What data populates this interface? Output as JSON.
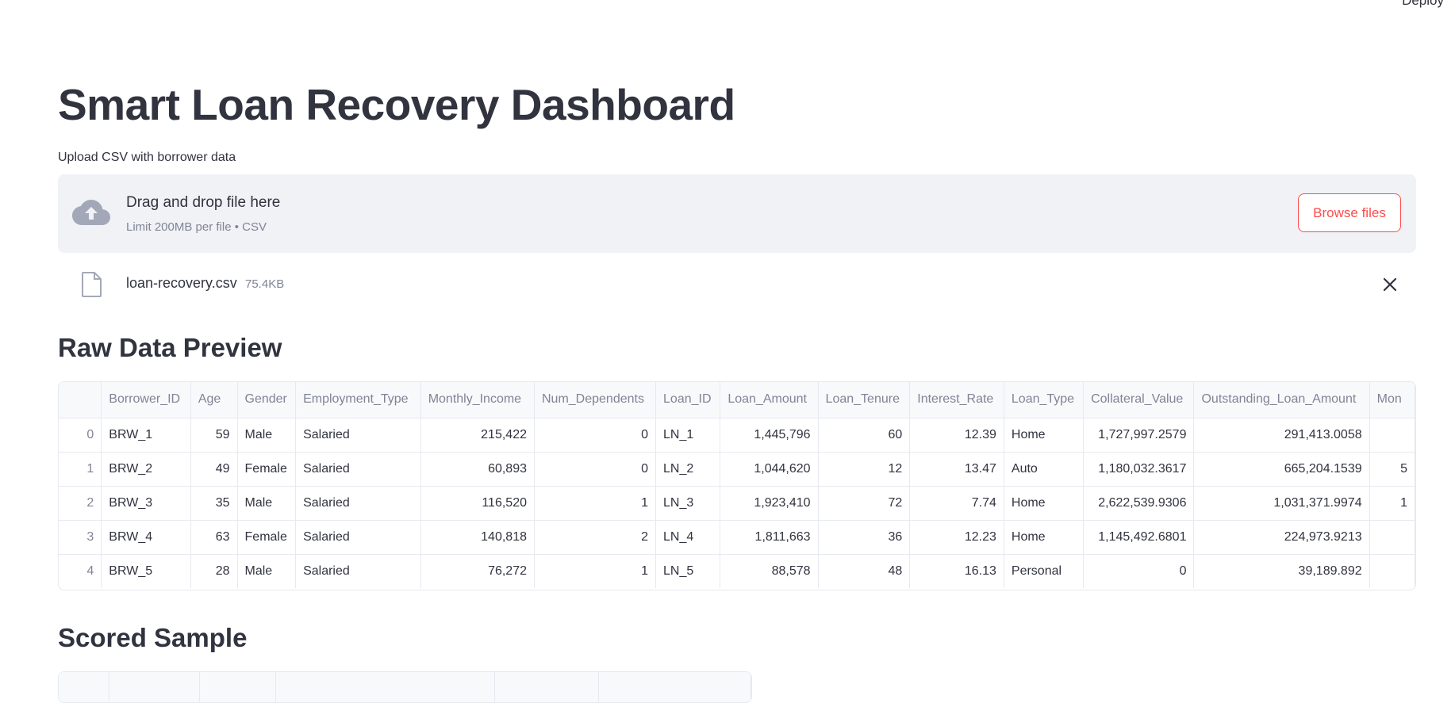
{
  "header": {
    "deploy_label": "Deploy"
  },
  "page": {
    "title": "Smart Loan Recovery Dashboard"
  },
  "uploader": {
    "label": "Upload CSV with borrower data",
    "drop_title": "Drag and drop file here",
    "drop_subtitle": "Limit 200MB per file • CSV",
    "browse_label": "Browse files",
    "file_name": "loan-recovery.csv",
    "file_size": "75.4KB"
  },
  "raw_preview": {
    "heading": "Raw Data Preview",
    "columns": [
      "",
      "Borrower_ID",
      "Age",
      "Gender",
      "Employment_Type",
      "Monthly_Income",
      "Num_Dependents",
      "Loan_ID",
      "Loan_Amount",
      "Loan_Tenure",
      "Interest_Rate",
      "Loan_Type",
      "Collateral_Value",
      "Outstanding_Loan_Amount",
      "Mon"
    ],
    "rows": [
      [
        "0",
        "BRW_1",
        "59",
        "Male",
        "Salaried",
        "215,422",
        "0",
        "LN_1",
        "1,445,796",
        "60",
        "12.39",
        "Home",
        "1,727,997.2579",
        "291,413.0058",
        ""
      ],
      [
        "1",
        "BRW_2",
        "49",
        "Female",
        "Salaried",
        "60,893",
        "0",
        "LN_2",
        "1,044,620",
        "12",
        "13.47",
        "Auto",
        "1,180,032.3617",
        "665,204.1539",
        "5"
      ],
      [
        "2",
        "BRW_3",
        "35",
        "Male",
        "Salaried",
        "116,520",
        "1",
        "LN_3",
        "1,923,410",
        "72",
        "7.74",
        "Home",
        "2,622,539.9306",
        "1,031,371.9974",
        "1"
      ],
      [
        "3",
        "BRW_4",
        "63",
        "Female",
        "Salaried",
        "140,818",
        "2",
        "LN_4",
        "1,811,663",
        "36",
        "12.23",
        "Home",
        "1,145,492.6801",
        "224,973.9213",
        ""
      ],
      [
        "4",
        "BRW_5",
        "28",
        "Male",
        "Salaried",
        "76,272",
        "1",
        "LN_5",
        "88,578",
        "48",
        "16.13",
        "Personal",
        "0",
        "39,189.892",
        ""
      ]
    ]
  },
  "scored_sample": {
    "heading": "Scored Sample"
  },
  "colors": {
    "accent": "#ff4b4b",
    "text": "#31333f",
    "muted": "#808495",
    "dropzone_bg": "#f0f2f6",
    "border": "#e6e9ef"
  },
  "icons": {
    "upload": "cloud-upload-icon",
    "file": "file-icon",
    "close": "close-icon"
  }
}
